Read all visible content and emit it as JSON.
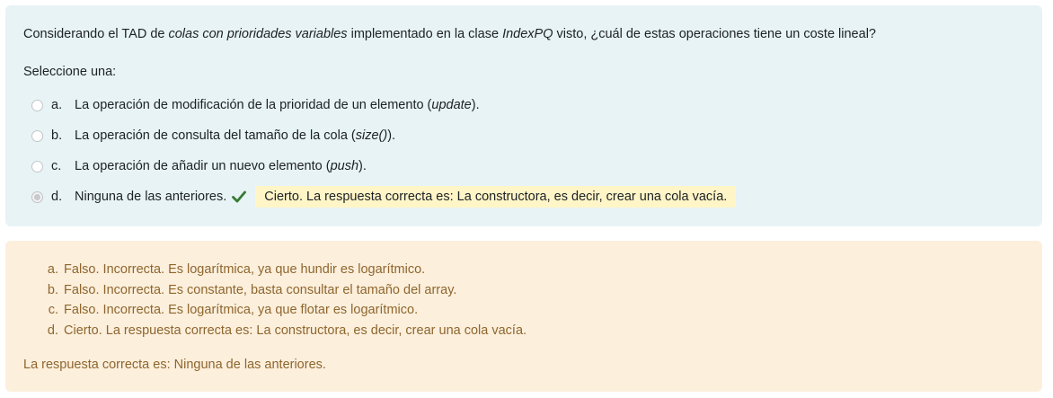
{
  "question": {
    "prompt_pre": "Considerando el TAD de ",
    "prompt_em1": "colas con prioridades variables",
    "prompt_mid": " implementado en la clase ",
    "prompt_em2": "IndexPQ",
    "prompt_post": " visto, ¿cuál de estas operaciones tiene un coste lineal?",
    "select_label": "Seleccione una:",
    "answers": [
      {
        "letter": "a.",
        "text_pre": "La operación de modificación de la prioridad de un elemento (",
        "text_em": "update",
        "text_post": ").",
        "selected": false
      },
      {
        "letter": "b.",
        "text_pre": "La operación de consulta del tamaño de la cola (",
        "text_em": "size()",
        "text_post": ").",
        "selected": false
      },
      {
        "letter": "c.",
        "text_pre": "La operación de añadir un nuevo elemento (",
        "text_em": "push",
        "text_post": ").",
        "selected": false
      },
      {
        "letter": "d.",
        "text_pre": "Ninguna de las anteriores.",
        "text_em": "",
        "text_post": "",
        "selected": true,
        "feedback": "Cierto. La respuesta correcta es: La constructora, es decir, crear una cola vacía."
      }
    ]
  },
  "general_feedback": {
    "items": [
      {
        "letter": "a.",
        "text": "Falso. Incorrecta. Es logarítmica, ya que hundir es logarítmico."
      },
      {
        "letter": "b.",
        "text": "Falso. Incorrecta. Es constante, basta consultar el tamaño del array."
      },
      {
        "letter": "c.",
        "text": "Falso. Incorrecta. Es logarítmica, ya que flotar es logarítmico."
      },
      {
        "letter": "d.",
        "text": "Cierto. La respuesta correcta es: La constructora, es decir, crear una cola vacía."
      }
    ],
    "right_answer": "La respuesta correcta es: Ninguna de las anteriores."
  },
  "colors": {
    "question_bg": "#e7f3f5",
    "feedback_bg": "#fcefdc",
    "feedback_text": "#8e662e",
    "inline_feedback_bg": "#fff5c7",
    "correct_check": "#357a32"
  }
}
